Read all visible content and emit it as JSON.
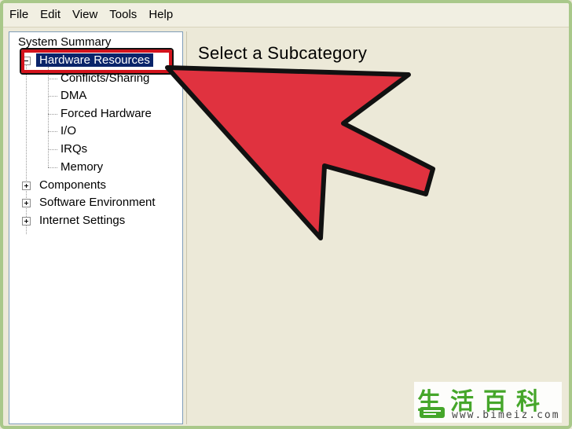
{
  "menu": [
    "File",
    "Edit",
    "View",
    "Tools",
    "Help"
  ],
  "tree": {
    "root": "System Summary",
    "hardware": "Hardware Resources",
    "hardware_children": [
      "Conflicts/Sharing",
      "DMA",
      "Forced Hardware",
      "I/O",
      "IRQs",
      "Memory"
    ],
    "collapsed": [
      "Components",
      "Software Environment",
      "Internet Settings"
    ]
  },
  "main": {
    "title": "Select a Subcategory"
  },
  "watermark": {
    "chars": "生活百科",
    "url": "www.bimeiz.com"
  },
  "colors": {
    "arrow": "#e0323f",
    "highlight": "#d3131c",
    "selection": "#0a246a",
    "watermark": "#45a62a"
  }
}
